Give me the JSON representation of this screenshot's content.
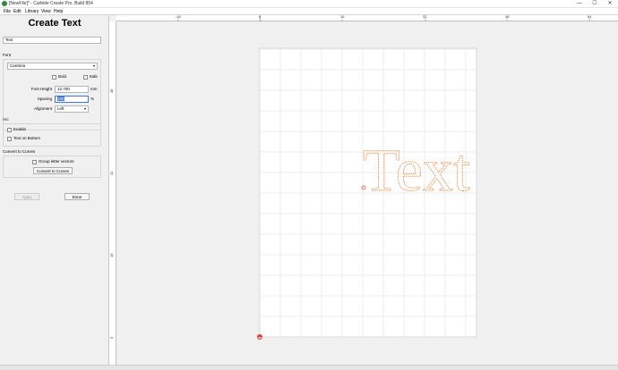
{
  "window": {
    "title": "[NewFile]* - Carbide Create Pro, Build 854",
    "controls": {
      "minimize": "—",
      "maximize": "☐",
      "close": "✕"
    }
  },
  "menu": {
    "items": [
      "File",
      "Edit",
      "Library",
      "View",
      "Help"
    ]
  },
  "panel": {
    "title": "Create Text",
    "text_value": "Text",
    "font_section": "Font",
    "font_value": "Cambria",
    "bold_label": "Bold",
    "italic_label": "Italic",
    "font_height_label": "Font Height",
    "font_height_value": "12.700",
    "font_height_unit": "mm",
    "spacing_label": "Spacing",
    "spacing_value": "100",
    "spacing_unit": "%",
    "alignment_label": "Alignment",
    "alignment_value": "Left",
    "arc_section": "Arc",
    "enable_label": "Enable",
    "text_on_bottom_label": "Text on Bottom",
    "convert_section": "Convert to Curves",
    "group_letter_label": "Group letter vectors",
    "convert_button": "Convert to Curves",
    "apply_button": "Apply",
    "done_button": "Done"
  },
  "rulers": {
    "top": [
      "-16",
      "0",
      "16",
      "32",
      "48",
      "64"
    ],
    "left": [
      "48",
      "32",
      "16",
      "0"
    ]
  },
  "canvas": {
    "preview_text": "Text",
    "preview_color": "#e8893a",
    "grid_color": "#dcdcdc",
    "origin_marker_color": "#e53935"
  }
}
